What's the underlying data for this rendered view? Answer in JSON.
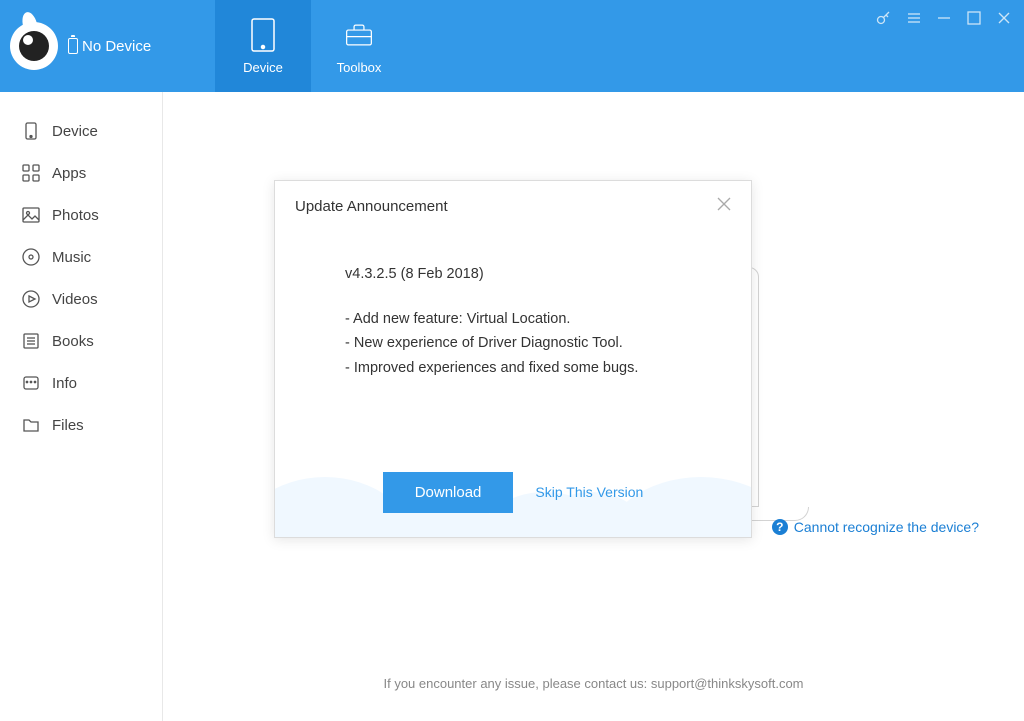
{
  "header": {
    "device_status": "No Device",
    "tabs": [
      {
        "label": "Device",
        "icon": "device-icon"
      },
      {
        "label": "Toolbox",
        "icon": "toolbox-icon"
      }
    ]
  },
  "sidebar": {
    "items": [
      {
        "label": "Device",
        "icon": "device"
      },
      {
        "label": "Apps",
        "icon": "apps"
      },
      {
        "label": "Photos",
        "icon": "photos"
      },
      {
        "label": "Music",
        "icon": "music"
      },
      {
        "label": "Videos",
        "icon": "videos"
      },
      {
        "label": "Books",
        "icon": "books"
      },
      {
        "label": "Info",
        "icon": "info"
      },
      {
        "label": "Files",
        "icon": "files"
      }
    ]
  },
  "main": {
    "recognize_link": "Cannot recognize the device?",
    "footer": "If you encounter any issue, please contact us: support@thinkskysoft.com"
  },
  "modal": {
    "title": "Update Announcement",
    "version": "v4.3.2.5 (8 Feb 2018)",
    "changes": [
      "- Add new feature: Virtual Location.",
      "- New experience of Driver Diagnostic Tool.",
      "- Improved experiences and fixed some bugs."
    ],
    "download_button": "Download",
    "skip_link": "Skip This Version"
  }
}
